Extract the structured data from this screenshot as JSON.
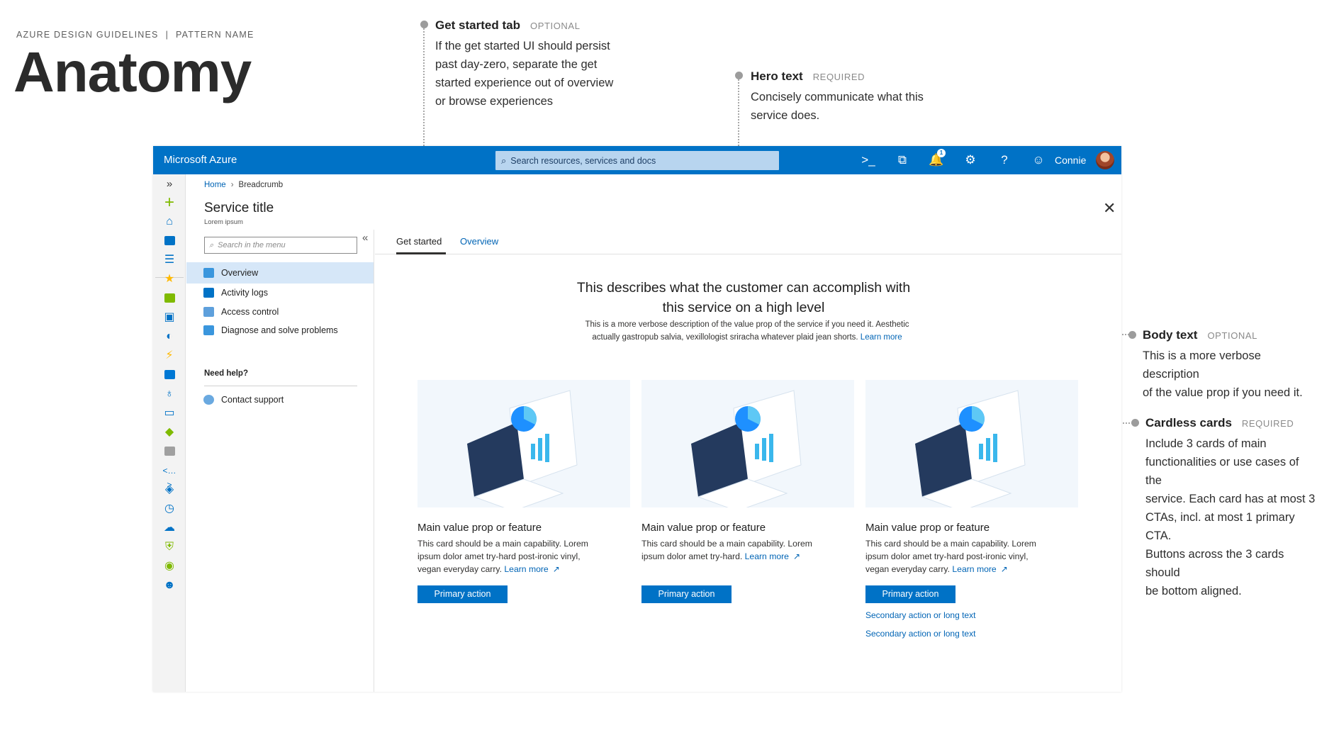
{
  "page": {
    "kicker_left": "AZURE DESIGN GUIDELINES",
    "kicker_sep": "|",
    "kicker_right": "PATTERN NAME",
    "title": "Anatomy"
  },
  "annotations": {
    "get_started_tab": {
      "name": "Get started tab",
      "tag": "OPTIONAL",
      "lines": [
        "If the get started UI should persist",
        "past day-zero, separate the get",
        "started experience out of overview",
        "or browse experiences"
      ]
    },
    "hero_text": {
      "name": "Hero text",
      "tag": "REQUIRED",
      "lines": [
        "Concisely communicate what this",
        "service does."
      ]
    },
    "body_text": {
      "name": "Body text",
      "tag": "OPTIONAL",
      "lines": [
        "This is a more verbose description",
        "of the value prop if you need it."
      ]
    },
    "cardless_cards": {
      "name": "Cardless cards",
      "tag": "REQUIRED",
      "lines": [
        "Include 3 cards of main",
        "functionalities or use cases of the",
        "service. Each card has at most 3",
        "CTAs, incl. at most 1 primary CTA.",
        "Buttons across the 3 cards should",
        "be bottom aligned."
      ]
    }
  },
  "topbar": {
    "brand": "Microsoft Azure",
    "search_placeholder": "Search resources, services and docs",
    "notification_count": "1",
    "user_name": "Connie",
    "icons": [
      "cloud-shell-icon",
      "directory-filter-icon",
      "notifications-icon",
      "settings-icon",
      "help-icon",
      "feedback-icon"
    ]
  },
  "breadcrumb": {
    "home": "Home",
    "current": "Breadcrumb"
  },
  "service": {
    "title": "Service title",
    "subtitle": "Lorem ipsum"
  },
  "menu": {
    "search_placeholder": "Search in the menu",
    "items": [
      {
        "label": "Overview",
        "icon": "overview-icon",
        "selected": true
      },
      {
        "label": "Activity logs",
        "icon": "activity-log-icon",
        "selected": false
      },
      {
        "label": "Access control",
        "icon": "access-control-icon",
        "selected": false
      },
      {
        "label": "Diagnose and solve problems",
        "icon": "diagnose-icon",
        "selected": false
      }
    ],
    "help_section": "Need help?",
    "help_items": [
      {
        "label": "Contact support",
        "icon": "support-icon"
      }
    ]
  },
  "tabs": [
    {
      "label": "Get started",
      "active": true
    },
    {
      "label": "Overview",
      "active": false
    }
  ],
  "hero": {
    "line1": "This describes what the customer can accomplish with",
    "line2": "this service on a high level"
  },
  "body": {
    "line1": "This is a more verbose description of the value prop of the service if you need it. Aesthetic",
    "line2": "actually gastropub salvia, vexillologist sriracha whatever plaid jean shorts.",
    "learn_more": "Learn more"
  },
  "cards": [
    {
      "title": "Main value prop or feature",
      "desc_lines": [
        "This card should be a main capability. Lorem",
        "ipsum dolor amet try-hard post-ironic vinyl,",
        "vegan everyday carry."
      ],
      "learn_more": "Learn more",
      "primary": "Primary action",
      "secondary": []
    },
    {
      "title": "Main value prop or feature",
      "desc_lines": [
        "This card should be a main capability. Lorem",
        "ipsum dolor amet try-hard."
      ],
      "learn_more": "Learn more",
      "primary": "Primary action",
      "secondary": []
    },
    {
      "title": "Main value prop or feature",
      "desc_lines": [
        "This card should be a main capability. Lorem",
        "ipsum dolor amet try-hard post-ironic vinyl,",
        "vegan everyday carry."
      ],
      "learn_more": "Learn more",
      "primary": "Primary action",
      "secondary": [
        "Secondary action or long text",
        "Secondary action or long text"
      ]
    }
  ],
  "colors": {
    "azure_blue": "#0072c6",
    "link": "#0064b5",
    "selected_bg": "#d6e7f8",
    "card_bg": "#f2f7fc"
  }
}
